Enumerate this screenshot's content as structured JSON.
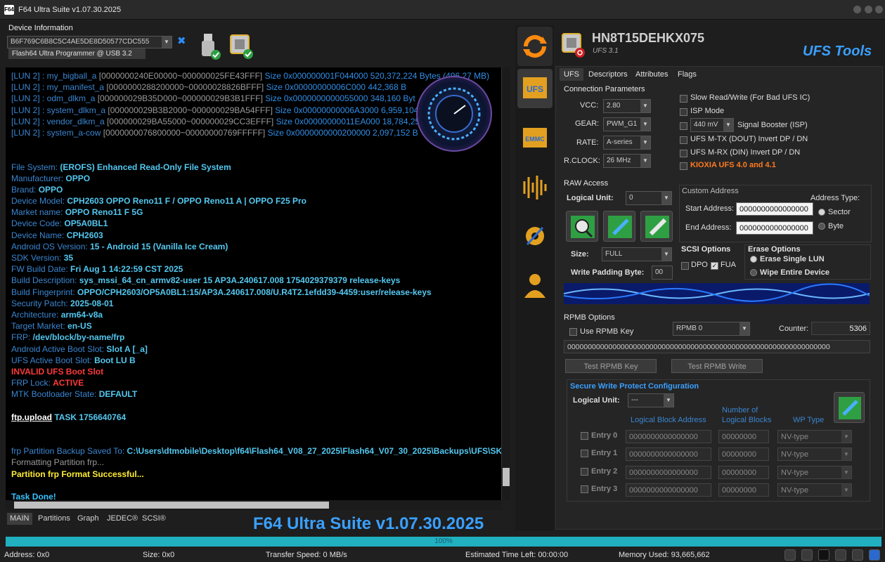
{
  "window": {
    "title": "F64 Ultra Suite v1.07.30.2025",
    "logo": "F64"
  },
  "device": {
    "label": "Device Information",
    "serial": "B6F769C6B8C5C4AE5DE8D50577CDC555",
    "programmer": "Flash64 Ultra Programmer @ USB 3.2"
  },
  "log": [
    [
      [
        "c-lbl",
        "[LUN 2]  : my_bigball_a "
      ],
      [
        "c-dim",
        "[0000000240E00000~000000025FE43FFF] "
      ],
      [
        "c-blue",
        "Size 0x000000001F044000  520,372,224 Bytes (496.27 MB)"
      ]
    ],
    [
      [
        "c-lbl",
        "[LUN 2]  : my_manifest_a "
      ],
      [
        "c-dim",
        "[0000000288200000~00000028826BFFF] "
      ],
      [
        "c-blue",
        "Size 0x00000000006C000  442,368 B"
      ]
    ],
    [
      [
        "c-lbl",
        "[LUN 2]  : odm_dlkm_a "
      ],
      [
        "c-dim",
        "[000000029B35D000~000000029B3B1FFF] "
      ],
      [
        "c-blue",
        "Size 0x0000000000055000  348,160 Byt"
      ]
    ],
    [
      [
        "c-lbl",
        "[LUN 2]  : system_dlkm_a "
      ],
      [
        "c-dim",
        "[000000029B3B2000~000000029BA54FFF] "
      ],
      [
        "c-blue",
        "Size 0x00000000006A3000  6,959,104"
      ]
    ],
    [
      [
        "c-lbl",
        "[LUN 2]  : vendor_dlkm_a "
      ],
      [
        "c-dim",
        "[000000029BA55000~000000029CC3EFFF] "
      ],
      [
        "c-blue",
        "Size 0x00000000011EA000  18,784,25"
      ]
    ],
    [
      [
        "c-lbl",
        "[LUN 2]  : system_a-cow "
      ],
      [
        "c-dim",
        "[0000000076800000~00000000769FFFFF] "
      ],
      [
        "c-blue",
        "Size 0x0000000000200000  2,097,152 B"
      ]
    ],
    [],
    [],
    [
      [
        "c-lbl",
        "File System: "
      ],
      [
        "c-val",
        "(EROFS) Enhanced Read-Only File System"
      ]
    ],
    [
      [
        "c-lbl",
        "Manufacturer: "
      ],
      [
        "c-val",
        "OPPO"
      ]
    ],
    [
      [
        "c-lbl",
        "Brand: "
      ],
      [
        "c-val",
        "OPPO"
      ]
    ],
    [
      [
        "c-lbl",
        "Device Model: "
      ],
      [
        "c-val",
        "CPH2603  OPPO Reno11 F / OPPO Reno11 A | OPPO F25 Pro"
      ]
    ],
    [
      [
        "c-lbl",
        "Market name: "
      ],
      [
        "c-val",
        "OPPO Reno11 F 5G"
      ]
    ],
    [
      [
        "c-lbl",
        "Device Code: "
      ],
      [
        "c-val",
        "OP5A0BL1"
      ]
    ],
    [
      [
        "c-lbl",
        "Device Name: "
      ],
      [
        "c-val",
        "CPH2603"
      ]
    ],
    [
      [
        "c-lbl",
        "Android OS Version: "
      ],
      [
        "c-val",
        "15 - Android 15 (Vanilla Ice Cream)"
      ]
    ],
    [
      [
        "c-lbl",
        "SDK Version: "
      ],
      [
        "c-val",
        "35"
      ]
    ],
    [
      [
        "c-lbl",
        "FW Build Date: "
      ],
      [
        "c-val",
        "Fri Aug  1 14:22:59 CST 2025"
      ]
    ],
    [
      [
        "c-lbl",
        "Build Description: "
      ],
      [
        "c-val",
        "sys_mssi_64_cn_armv82-user 15 AP3A.240617.008 1754029379379 release-keys"
      ]
    ],
    [
      [
        "c-lbl",
        "Build Fingerprint: "
      ],
      [
        "c-val",
        "OPPO/CPH2603/OP5A0BL1:15/AP3A.240617.008/U.R4T2.1efdd39-4459:user/release-keys"
      ]
    ],
    [
      [
        "c-lbl",
        "Security Patch: "
      ],
      [
        "c-val",
        "2025-08-01"
      ]
    ],
    [
      [
        "c-lbl",
        "Architecture: "
      ],
      [
        "c-val",
        "arm64-v8a"
      ]
    ],
    [
      [
        "c-lbl",
        "Target Market: "
      ],
      [
        "c-val",
        "en-US"
      ]
    ],
    [
      [
        "c-lbl",
        "FRP: "
      ],
      [
        "c-val",
        "/dev/block/by-name/frp"
      ]
    ],
    [
      [
        "c-lbl",
        "Android Active Boot Slot: "
      ],
      [
        "c-val",
        "Slot A [_a]"
      ]
    ],
    [
      [
        "c-lbl",
        "UFS Active Boot Slot: "
      ],
      [
        "c-val",
        "Boot LU B"
      ]
    ],
    [
      [
        "c-red",
        " INVALID UFS Boot Slot"
      ]
    ],
    [
      [
        "c-lbl",
        "FRP Lock: "
      ],
      [
        "c-red",
        "ACTIVE"
      ]
    ],
    [
      [
        "c-lbl",
        "MTK Bootloader State: "
      ],
      [
        "c-val",
        "DEFAULT"
      ]
    ],
    [],
    [
      [
        "c-wht",
        " ftp.upload"
      ],
      [
        "c-val",
        " TASK 1756640764"
      ]
    ],
    [],
    [],
    [
      [
        "c-lbl",
        "frp Partition Backup Saved To: "
      ],
      [
        "c-val",
        "C:\\Users\\dtmobile\\Desktop\\f64\\Flash64_V08_27_2025\\Flash64_V07_30_2025\\Backups\\UFS\\SKhy"
      ]
    ],
    [
      [
        "c-dim",
        " Formatting Partition frp..."
      ]
    ],
    [
      [
        "c-yel",
        " Partition frp Format Successful..."
      ]
    ],
    [],
    [
      [
        "c-cyan",
        " Task Done!"
      ]
    ]
  ],
  "bottom_tabs": [
    "MAIN",
    "Partitions",
    "Graph",
    "JEDEC®",
    "SCSI®"
  ],
  "footer_title": "F64 Ultra Suite v1.07.30.2025",
  "chip": {
    "name": "HN8T15DEHKX075",
    "sub": "UFS 3.1",
    "brand": "UFS Tools"
  },
  "tabs": [
    "UFS",
    "Descriptors",
    "Attributes",
    "Flags"
  ],
  "conn": {
    "header": "Connection Parameters",
    "vcc_label": "VCC:",
    "vcc": "2.80",
    "gear_label": "GEAR:",
    "gear": "PWM_G1",
    "rate_label": "RATE:",
    "rate": "A-series",
    "rclock_label": "R.CLOCK:",
    "rclock": "26 MHz",
    "opt1": "Slow Read/Write (For Bad UFS IC)",
    "opt2": "ISP Mode",
    "mv": "440 mV",
    "opt3": "Signal Booster (ISP)",
    "opt4": "UFS M-TX (DOUT) Invert DP / DN",
    "opt5": "UFS M-RX (DIN) Invert DP / DN",
    "opt6": "KIOXIA UFS 4.0 and 4.1"
  },
  "raw": {
    "header": "RAW Access",
    "lu_label": "Logical Unit:",
    "lu": "0",
    "custom": "Custom Address",
    "addr_type": "Address Type:",
    "start_label": "Start Address:",
    "start": "0000000000000000",
    "end_label": "End Address:",
    "end": "0000000000000000",
    "sector": "Sector",
    "byte": "Byte",
    "size_label": "Size:",
    "size": "FULL",
    "pad_label": "Write Padding Byte:",
    "pad": "00",
    "scsi": "SCSI Options",
    "dpo": "DPO",
    "fua": "FUA",
    "erase": "Erase Options",
    "erase1": "Erase Single LUN",
    "erase2": "Wipe Entire Device"
  },
  "rpmb": {
    "header": "RPMB Options",
    "use_key": "Use RPMB Key",
    "sel": "RPMB 0",
    "counter_label": "Counter:",
    "counter": "5306",
    "key": "0000000000000000000000000000000000000000000000000000000000000000",
    "test_key": "Test RPMB Key",
    "test_write": "Test RPMB Write"
  },
  "swp": {
    "header": "Secure Write Protect Configuration",
    "lu_label": "Logical Unit:",
    "lu": "---",
    "col1": "Logical Block Address",
    "col2a": "Number of",
    "col2b": "Logical Blocks",
    "col3": "WP Type",
    "entries": [
      {
        "label": "Entry 0",
        "lba": "0000000000000000",
        "num": "00000000",
        "wp": "NV-type"
      },
      {
        "label": "Entry 1",
        "lba": "0000000000000000",
        "num": "00000000",
        "wp": "NV-type"
      },
      {
        "label": "Entry 2",
        "lba": "0000000000000000",
        "num": "00000000",
        "wp": "NV-type"
      },
      {
        "label": "Entry 3",
        "lba": "0000000000000000",
        "num": "00000000",
        "wp": "NV-type"
      }
    ]
  },
  "progress": {
    "value": 1.0,
    "label": "100%"
  },
  "status": {
    "address": "Address: 0x0",
    "size": "Size: 0x0",
    "speed": "Transfer Speed: 0 MB/s",
    "eta": "Estimated Time Left: 00:00:00",
    "memory": "Memory Used: 93,665,662"
  },
  "sidebar_icons": [
    "refresh-icon",
    "ufs-icon",
    "emmc-icon",
    "signal-icon",
    "settings-icon",
    "user-icon"
  ],
  "colors": {
    "accent": "#3aa0ff",
    "progress": "#20b0c0",
    "log_bg": "#000000",
    "red": "#ff3a3a"
  }
}
